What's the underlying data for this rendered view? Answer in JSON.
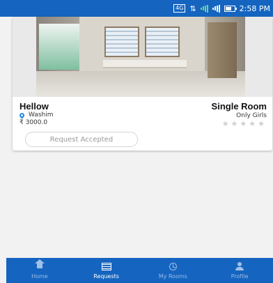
{
  "status_bar": {
    "network_badge": "4G",
    "time": "2:58 PM"
  },
  "listing": {
    "title": "Hellow",
    "location": "Washim",
    "price": "₹ 3000.0",
    "room_type": "Single Room",
    "gender": "Only Girls",
    "stars": "★★★★★",
    "rating": 0,
    "status": "Request Accepted"
  },
  "bottom_nav": {
    "items": [
      {
        "label": "Home",
        "icon": "home-icon"
      },
      {
        "label": "Requests",
        "icon": "list-icon"
      },
      {
        "label": "My Rooms",
        "icon": "clock-icon"
      },
      {
        "label": "Profile",
        "icon": "person-icon"
      }
    ],
    "active": "Requests"
  },
  "colors": {
    "primary": "#1565c0",
    "pin": "#1e88e5",
    "star_empty": "#cfcfcf"
  }
}
